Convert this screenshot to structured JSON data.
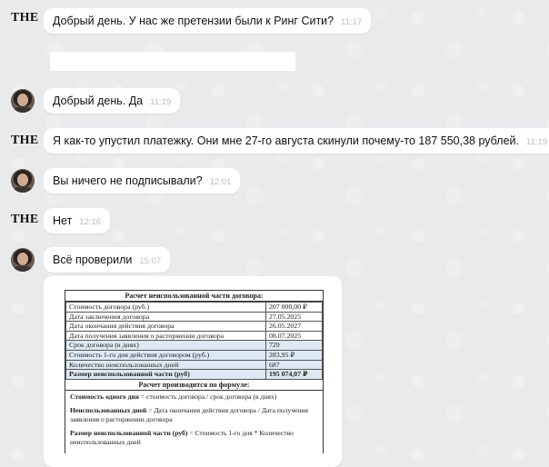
{
  "messages": [
    {
      "sender": "THE",
      "text": "Добрый день. У нас же претензии были к Ринг Сити?",
      "time": "11:17"
    },
    {
      "sender": "avatar",
      "text": "Добрый день. Да",
      "time": "11:19"
    },
    {
      "sender": "THE",
      "text": "Я как-то упустил платежку. Они мне 27-го августа скинули почему-то 187 550,38 рублей.",
      "time": "11:19"
    },
    {
      "sender": "avatar",
      "text": "Вы ничего не подписывали?",
      "time": "12:01"
    },
    {
      "sender": "THE",
      "text": "Нет",
      "time": "12:16"
    },
    {
      "sender": "avatar",
      "text": "Всё проверили",
      "time": "15:07"
    }
  ],
  "document": {
    "title": "Расчет неиспользованной части договора:",
    "rows": [
      {
        "label": "Стоимость договора (руб.)",
        "value": "207 000,00 ₽"
      },
      {
        "label": "Дата заключения договора",
        "value": "27.05.2025"
      },
      {
        "label": "Дата окончания действия договора",
        "value": "26.05.2027"
      },
      {
        "label": "Дата получения заявления о расторжении договора",
        "value": "08.07.2025"
      },
      {
        "label": "Срок договора (в днях)",
        "value": "729"
      },
      {
        "label": "Стоимость 1-го дня действия договором (руб.)",
        "value": "283,95 ₽"
      },
      {
        "label": "Количество неиспользованных дней",
        "value": "687"
      },
      {
        "label": "Размер неиспользованной части (руб)",
        "value": "195 074,07 ₽"
      }
    ],
    "formula_title": "Расчет производится по формуле:",
    "formula_1_bold": "Стоимость одного дня",
    "formula_1_rest": " = стоимость договора / срок договора (в днях)",
    "formula_2_bold": "Неиспользованных дней",
    "formula_2_rest": " = Дата окончания действия договора / Дата получения заявления о расторжении договора",
    "formula_3_bold": "Размер неиспользованной части (руб)",
    "formula_3_rest": " = Стоимость 1-го дня * Количество неиспользованных дней"
  }
}
